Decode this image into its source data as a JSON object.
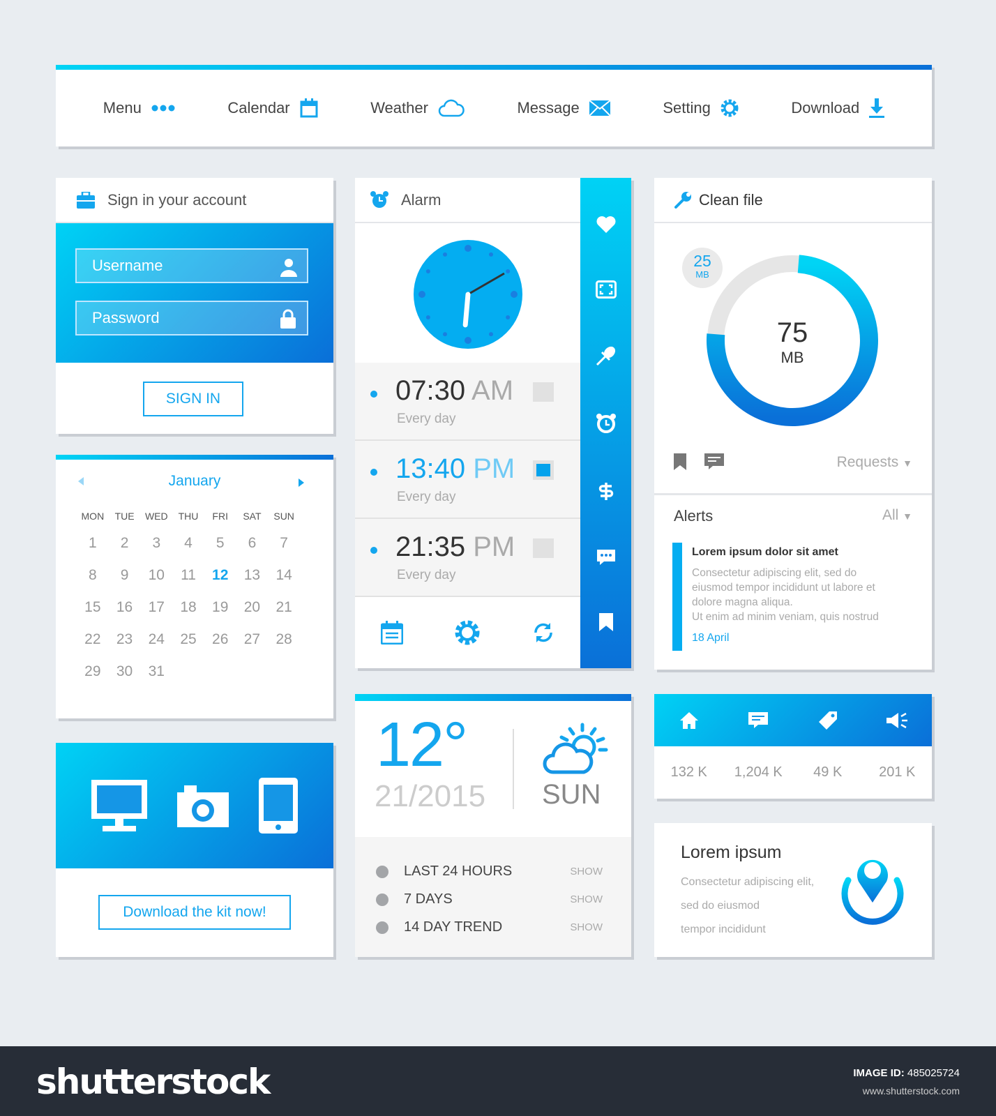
{
  "nav": {
    "items": [
      {
        "label": "Menu",
        "icon": "dots-icon"
      },
      {
        "label": "Calendar",
        "icon": "calendar-icon"
      },
      {
        "label": "Weather",
        "icon": "cloud-icon"
      },
      {
        "label": "Message",
        "icon": "envelope-icon"
      },
      {
        "label": "Setting",
        "icon": "gear-icon"
      },
      {
        "label": "Download",
        "icon": "download-icon"
      }
    ]
  },
  "signin": {
    "title": "Sign in your account",
    "username_placeholder": "Username",
    "password_placeholder": "Password",
    "button": "SIGN IN"
  },
  "calendar": {
    "month": "January",
    "weekdays": [
      "MON",
      "TUE",
      "WED",
      "THU",
      "FRI",
      "SAT",
      "SUN"
    ],
    "weeks": [
      [
        "1",
        "2",
        "3",
        "4",
        "5",
        "6",
        "7"
      ],
      [
        "8",
        "9",
        "10",
        "11",
        "12",
        "13",
        "14"
      ],
      [
        "15",
        "16",
        "17",
        "18",
        "19",
        "20",
        "21"
      ],
      [
        "22",
        "23",
        "24",
        "25",
        "26",
        "27",
        "28"
      ],
      [
        "29",
        "30",
        "31",
        "",
        "",
        "",
        ""
      ]
    ],
    "selected": "12"
  },
  "download_kit": {
    "button": "Download the kit now!"
  },
  "alarm": {
    "title": "Alarm",
    "clock": {
      "hour": 6,
      "minute": 10
    },
    "alarms": [
      {
        "time": "07:30",
        "period": "AM",
        "repeat": "Every day",
        "active": false
      },
      {
        "time": "13:40",
        "period": "PM",
        "repeat": "Every day",
        "active": true
      },
      {
        "time": "21:35",
        "period": "PM",
        "repeat": "Every day",
        "active": false
      }
    ],
    "sidebar_icons": [
      "heart-icon",
      "fullscreen-icon",
      "pin-icon",
      "alarm-icon",
      "dollar-icon",
      "chat-icon",
      "bookmark-icon"
    ],
    "footer_icons": [
      "calendar-icon",
      "gear-icon",
      "refresh-icon"
    ]
  },
  "weather": {
    "temp": "12°",
    "date": "21/2015",
    "day": "SUN",
    "rows": [
      {
        "label": "LAST 24 HOURS",
        "action": "SHOW"
      },
      {
        "label": "7 DAYS",
        "action": "SHOW"
      },
      {
        "label": "14 DAY TREND",
        "action": "SHOW"
      }
    ]
  },
  "clean": {
    "title": "Clean file",
    "used": "75",
    "used_unit": "MB",
    "free": "25",
    "free_unit": "MB",
    "percent": 75,
    "requests": "Requests"
  },
  "alerts": {
    "title": "Alerts",
    "filter": "All",
    "item": {
      "title": "Lorem ipsum dolor sit amet",
      "lines": [
        "Consectetur adipiscing elit, sed do",
        "eiusmod tempor incididunt ut labore et",
        "dolore magna aliqua.",
        "Ut enim ad minim veniam, quis nostrud"
      ],
      "date": "18 April"
    }
  },
  "stats": {
    "items": [
      {
        "icon": "home-icon",
        "value": "132 K"
      },
      {
        "icon": "message-icon",
        "value": "1,204 K"
      },
      {
        "icon": "tag-icon",
        "value": "49 K"
      },
      {
        "icon": "megaphone-icon",
        "value": "201 K"
      }
    ]
  },
  "location": {
    "title": "Lorem ipsum",
    "lines": [
      "Consectetur adipiscing elit,",
      "sed do eiusmod",
      "tempor incididunt"
    ]
  },
  "footer": {
    "logo": "shutterstock",
    "image_id_label": "IMAGE ID:",
    "image_id": "485025724",
    "site": "www.shutterstock.com"
  },
  "colors": {
    "accent": "#14a6ee",
    "gradient_start": "#00d2f5",
    "gradient_end": "#0a70d8",
    "footer_bg": "#272d37"
  }
}
